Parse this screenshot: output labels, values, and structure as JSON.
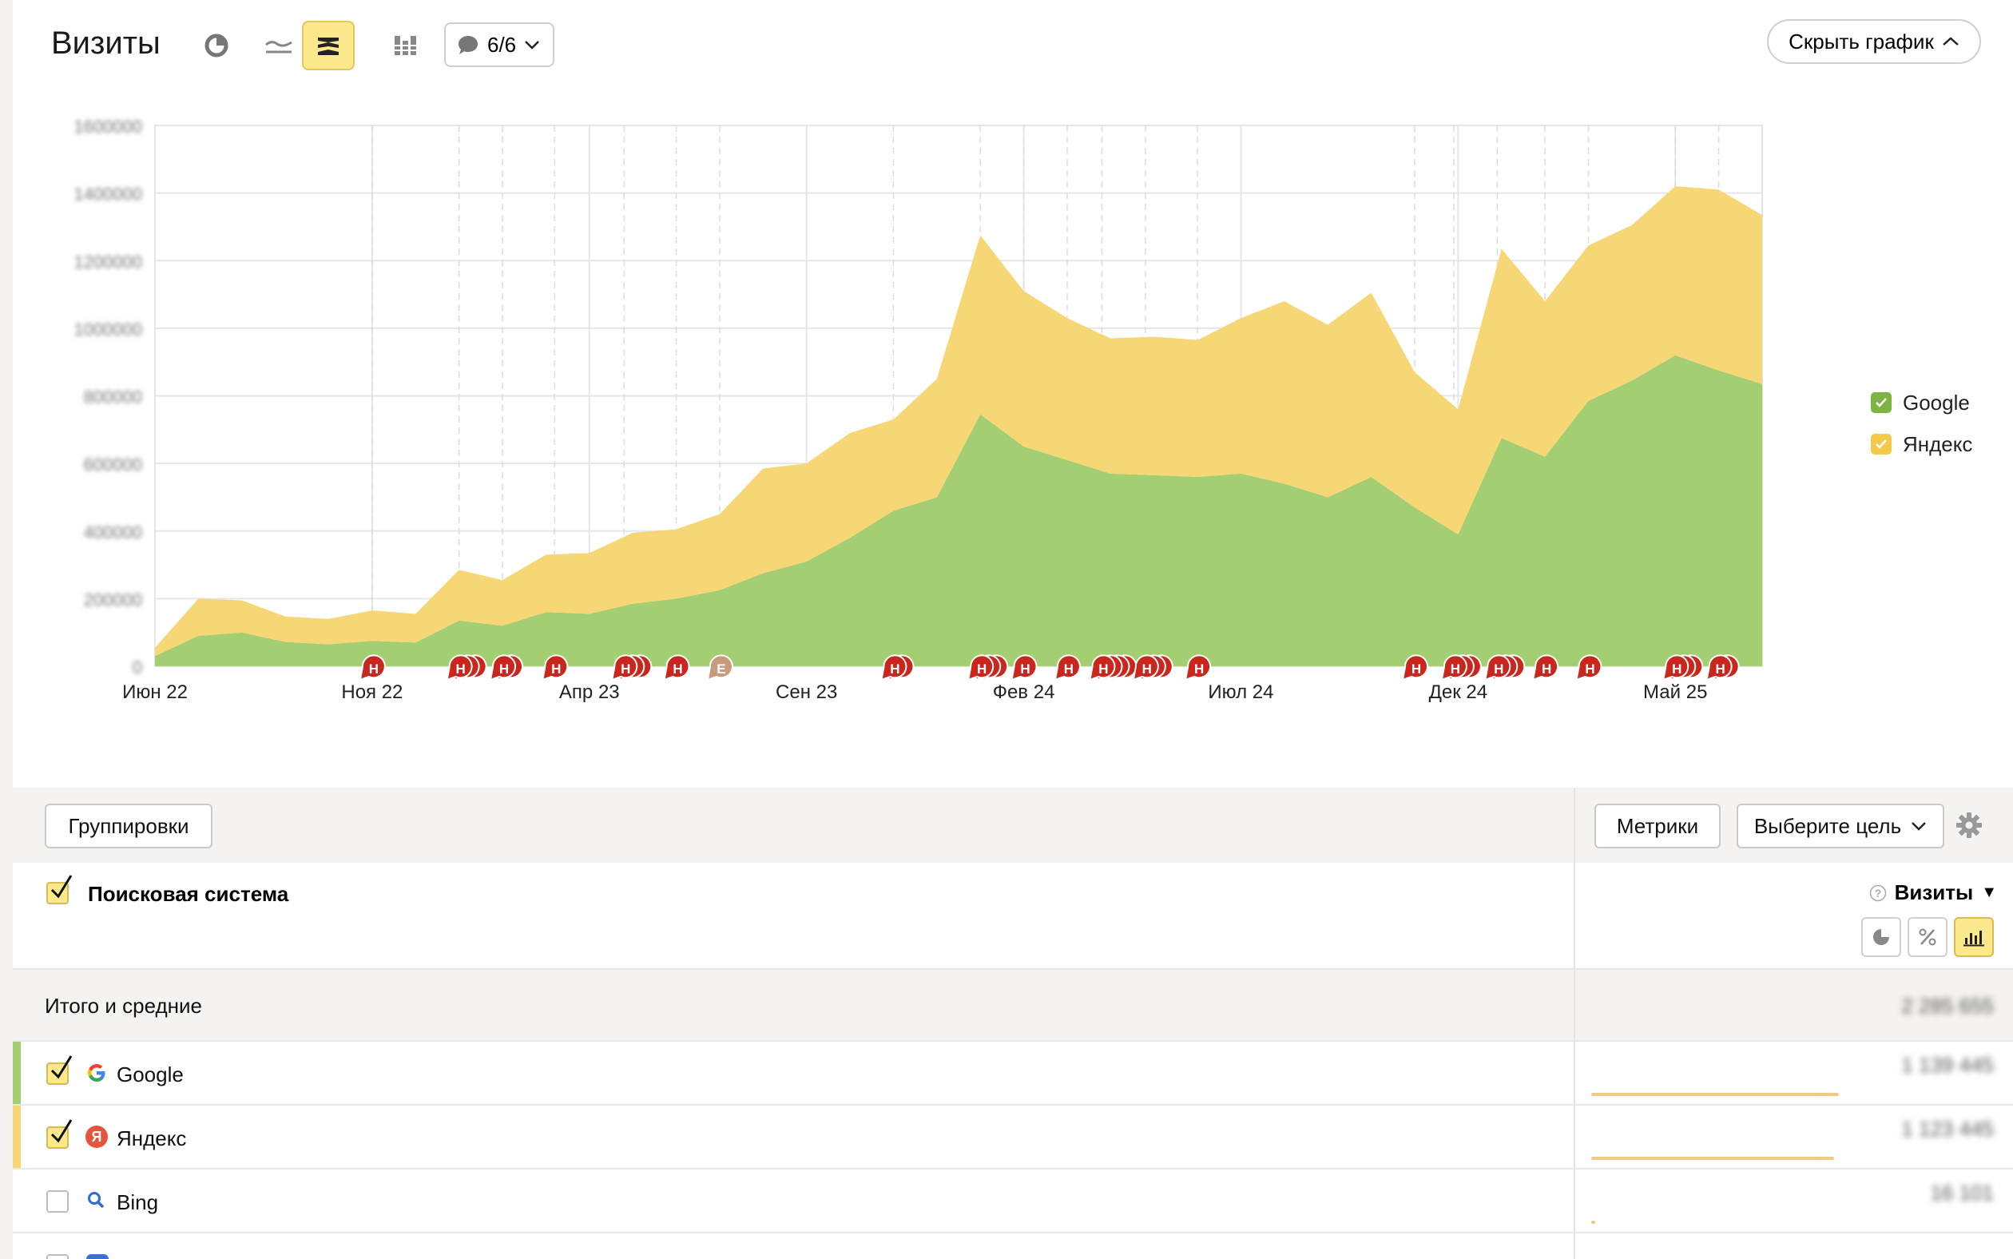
{
  "header": {
    "title": "Визиты",
    "annotations_label": "6/6",
    "hide_chart_label": "Скрыть график"
  },
  "chart_data": {
    "type": "area",
    "stacked": true,
    "title": "",
    "x": [
      "Июн 22",
      "Июл 22",
      "Авг 22",
      "Сен 22",
      "Окт 22",
      "Ноя 22",
      "Дек 22",
      "Янв 23",
      "Фев 23",
      "Мар 23",
      "Апр 23",
      "Май 23",
      "Июн 23",
      "Июл 23",
      "Авг 23",
      "Сен 23",
      "Окт 23",
      "Ноя 23",
      "Дек 23",
      "Янв 24",
      "Фев 24",
      "Мар 24",
      "Апр 24",
      "Май 24",
      "Июн 24",
      "Июл 24",
      "Авг 24",
      "Сен 24",
      "Окт 24",
      "Ноя 24",
      "Дек 24",
      "Янв 25",
      "Фев 25",
      "Мар 25",
      "Апр 25",
      "Май 25",
      "Июн 25",
      "Июл 25"
    ],
    "x_tick_labels": [
      "Июн 22",
      "Ноя 22",
      "Апр 23",
      "Сен 23",
      "Фев 24",
      "Июл 24",
      "Дек 24",
      "Май 25"
    ],
    "y_tick_labels": [
      "1600000",
      "1400000",
      "1200000",
      "1000000",
      "800000",
      "600000",
      "400000",
      "200000",
      "0"
    ],
    "ylim": [
      0,
      1600000
    ],
    "grid": true,
    "legend_position": "right",
    "series": [
      {
        "name": "Google",
        "color": "#a3cf72",
        "values": [
          30000,
          90000,
          100000,
          72000,
          65000,
          75000,
          70000,
          135000,
          120000,
          160000,
          155000,
          185000,
          200000,
          225000,
          275000,
          310000,
          380000,
          460000,
          500000,
          745000,
          650000,
          610000,
          570000,
          565000,
          560000,
          570000,
          540000,
          500000,
          560000,
          470000,
          390000,
          675000,
          620000,
          785000,
          845000,
          920000,
          875000,
          835000
        ]
      },
      {
        "name": "Яндекс",
        "color": "#f6d675",
        "values": [
          25000,
          110000,
          95000,
          75000,
          75000,
          90000,
          85000,
          150000,
          135000,
          170000,
          180000,
          210000,
          205000,
          225000,
          310000,
          290000,
          310000,
          270000,
          350000,
          530000,
          460000,
          420000,
          400000,
          410000,
          405000,
          460000,
          540000,
          510000,
          545000,
          400000,
          370000,
          560000,
          460000,
          460000,
          460000,
          500000,
          535000,
          500000
        ]
      }
    ],
    "events": [
      {
        "x": 5.0,
        "type": "Н",
        "count": 1
      },
      {
        "x": 7.0,
        "type": "Н",
        "count": 3
      },
      {
        "x": 8.0,
        "type": "Н",
        "count": 2
      },
      {
        "x": 9.2,
        "type": "Н",
        "count": 1
      },
      {
        "x": 10.8,
        "type": "Н",
        "count": 3
      },
      {
        "x": 12.0,
        "type": "Н",
        "count": 1
      },
      {
        "x": 13.0,
        "type": "Е",
        "count": 1
      },
      {
        "x": 17.0,
        "type": "Н",
        "count": 2
      },
      {
        "x": 19.0,
        "type": "Н",
        "count": 3
      },
      {
        "x": 20.0,
        "type": "Н",
        "count": 1
      },
      {
        "x": 21.0,
        "type": "Н",
        "count": 1
      },
      {
        "x": 21.8,
        "type": "Н",
        "count": 4
      },
      {
        "x": 22.8,
        "type": "Н",
        "count": 3
      },
      {
        "x": 24.0,
        "type": "Н",
        "count": 1
      },
      {
        "x": 29.0,
        "type": "Н",
        "count": 1
      },
      {
        "x": 29.9,
        "type": "Н",
        "count": 3
      },
      {
        "x": 30.9,
        "type": "Н",
        "count": 3
      },
      {
        "x": 32.0,
        "type": "Н",
        "count": 1
      },
      {
        "x": 33.0,
        "type": "Н",
        "count": 1
      },
      {
        "x": 35.0,
        "type": "Н",
        "count": 3
      },
      {
        "x": 36.0,
        "type": "Н",
        "count": 2
      }
    ]
  },
  "table": {
    "groupings_label": "Группировки",
    "metrics_label": "Метрики",
    "goal_label": "Выберите цель",
    "dimension_header": "Поисковая система",
    "metric_header": "Визиты",
    "metric_sort": "▼",
    "totals_label": "Итого и средние",
    "totals_value": "2 285 655",
    "rows": [
      {
        "name": "Google",
        "checked": true,
        "stripe": "#a3cf72",
        "value": "1 139 445",
        "share": 1.0
      },
      {
        "name": "Яндекс",
        "checked": true,
        "stripe": "#f6d675",
        "value": "1 123 445",
        "share": 0.98
      },
      {
        "name": "Bing",
        "checked": false,
        "stripe": "",
        "value": "16 101",
        "share": 0.015
      },
      {
        "name": "",
        "checked": false,
        "stripe": "",
        "value": "",
        "share": 0
      }
    ]
  },
  "icons": {
    "chart_pie": "pie-icon",
    "chart_line": "line-icon",
    "chart_area": "stacked-area-icon",
    "chart_bar": "stacked-bar-icon",
    "annotations": "speech-bubble-icon",
    "settings": "gear-icon"
  }
}
